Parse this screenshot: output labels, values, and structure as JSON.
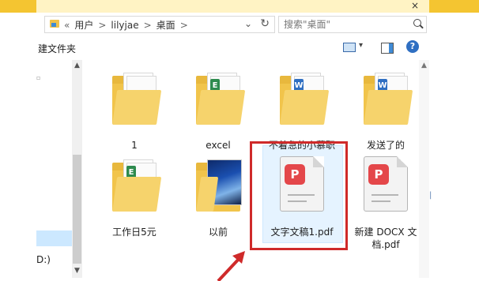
{
  "window": {
    "close_glyph": "×"
  },
  "address_bar": {
    "prefix": "«",
    "crumbs": [
      "用户",
      "lilyjae",
      "桌面"
    ],
    "separator": ">"
  },
  "search": {
    "placeholder": "搜索\"桌面\""
  },
  "command_bar": {
    "new_folder_label": "建文件夹",
    "help_glyph": "?"
  },
  "nav_pane": {
    "drive_label": "D:)"
  },
  "items": [
    {
      "label": "1",
      "kind": "folder"
    },
    {
      "label": "excel",
      "kind": "folder",
      "badge": "excel-icon",
      "badge_color": "#2e8b4e"
    },
    {
      "label": "不着急的小慕职",
      "kind": "folder",
      "badge": "word-icon",
      "badge_color": "#2f6fc2"
    },
    {
      "label": "发送了的",
      "kind": "folder",
      "badge": "word-icon",
      "badge_color": "#2f6fc2"
    },
    {
      "label": "工作日5元",
      "kind": "folder",
      "badge": "excel-icon",
      "badge_color": "#2e8b4e"
    },
    {
      "label": "以前",
      "kind": "photo-folder"
    },
    {
      "label": "文字文稿1.pdf",
      "kind": "pdf",
      "selected": true
    },
    {
      "label": "新建 DOCX 文档.pdf",
      "kind": "pdf"
    }
  ],
  "colors": {
    "accent": "#f4c531",
    "highlight": "#cf2a2a",
    "pdf_logo": "#e4474a"
  }
}
